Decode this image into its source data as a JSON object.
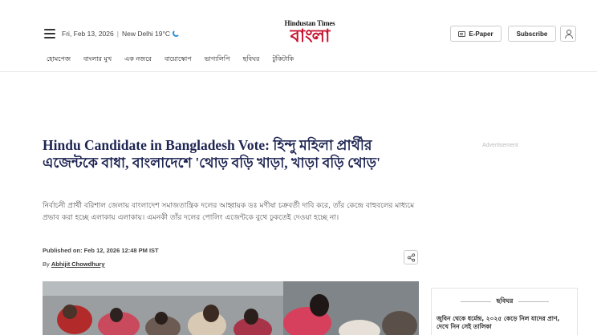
{
  "header": {
    "date": "Fri, Feb 13, 2026",
    "weather": "New Delhi 19°C",
    "logo_top": "Hindustan Times",
    "logo_main": "বাংলা",
    "epaper_label": "E-Paper",
    "subscribe_label": "Subscribe"
  },
  "nav": {
    "items": [
      "হোমপেজ",
      "বাংলার মুখ",
      "এক নজরে",
      "বায়োস্কোপ",
      "ভাগ্যলিপি",
      "ছবিঘর",
      "টুকিটাকি"
    ]
  },
  "article": {
    "headline": "Hindu Candidate in Bangladesh Vote: হিন্দু মহিলা প্রার্থীর এজেন্টকে বাধা, বাংলাদেশে 'থোড় বড়ি খাড়া, খাড়া বড়ি থোড়'",
    "summary": "নির্বাচনী প্রার্থী বরিশাল জেলায় বাংলাদেশ সমাজতান্ত্রিক দলের আহ্বায়ক ডঃ মণীষা চক্রবর্তী দাবি করে, তাঁর কেন্দ্রে বাহুবলের মাধ্যমে প্রভাব করা হচ্ছে এলাকায় এলাকায়। এমনকী তাঁর দলের পোলিং এজেন্টকে বুথে ঢুকতেই দেওয়া হচ্ছে না।",
    "published": "Published on: Feb 12, 2026 12:48 PM IST",
    "by_label": "By",
    "author": "Abhijit Chowdhury"
  },
  "sidebar": {
    "advertisement_label": "Advertisement",
    "gallery_title": "ছবিঘর",
    "gallery_item": "জুবিন থেকে ধর্মেন্দ্র, ২০২৫ কেড়ে নিল যাদের প্রাণ, দেখে নিন সেই তালিকা"
  },
  "colors": {
    "brand_red": "#c8102e",
    "headline_navy": "#1d2452",
    "weather_blue": "#2b8fd6"
  }
}
